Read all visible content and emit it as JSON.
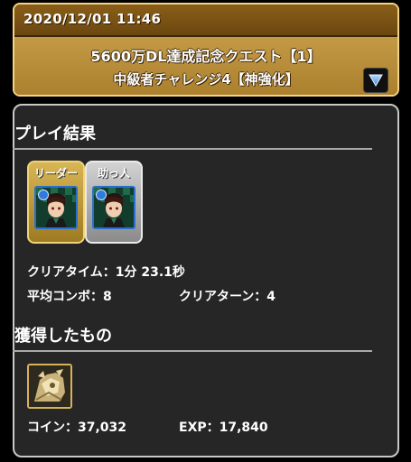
{
  "header": {
    "datetime": "2020/12/01 11:46",
    "quest_title": "5600万DL達成記念クエスト【1】",
    "quest_subtitle": "中級者チャレンジ4【神強化】",
    "expand_icon": "triangle-down-icon"
  },
  "result": {
    "section_title": "プレイ結果",
    "leader_label": "リーダー",
    "helper_label": "助っ人",
    "clear_time": "クリアタイム：1分 23.1秒",
    "avg_combo": "平均コンボ：8",
    "clear_turns": "クリアターン：4"
  },
  "rewards": {
    "section_title": "獲得したもの",
    "coin": "コイン：37,032",
    "exp": "EXP：17,840"
  },
  "colors": {
    "gold": "#c9a046",
    "panel_bg": "#262626",
    "panel_border": "#c8c8c8",
    "attribute_blue": "#2f7be0"
  }
}
